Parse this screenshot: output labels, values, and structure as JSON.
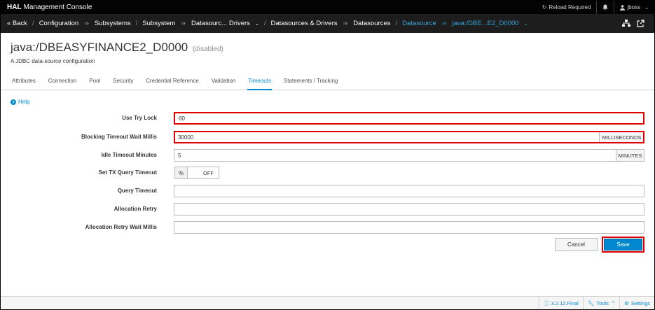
{
  "topbar": {
    "brand_bold": "HAL",
    "brand_rest": "Management Console",
    "reload": "Reload Required",
    "user": "jboss"
  },
  "breadcrumb": {
    "back": "« Back",
    "configuration": "Configuration",
    "subsystems": "Subsystems",
    "subsystem": "Subsystem",
    "subsystem_value": "Datasourc... Drivers",
    "ds_drivers": "Datasources & Drivers",
    "datasources": "Datasources",
    "datasource": "Datasource",
    "datasource_value": "java:/DBE...E2_D0000"
  },
  "header": {
    "title": "java:/DBEASYFINANCE2_D0000",
    "status": "(disabled)",
    "description": "A JDBC data-source configuration"
  },
  "tabs": [
    "Attributes",
    "Connection",
    "Pool",
    "Security",
    "Credential Reference",
    "Validation",
    "Timeouts",
    "Statements / Tracking"
  ],
  "help": "Help",
  "form": {
    "use_try_lock": {
      "label": "Use Try Lock",
      "value": "60"
    },
    "blocking_timeout": {
      "label": "Blocking Timeout Wait Millis",
      "value": "30000",
      "unit": "MILLISECONDS"
    },
    "idle_timeout": {
      "label": "Idle Timeout Minutes",
      "value": "5",
      "unit": "MINUTES"
    },
    "set_tx_query_timeout": {
      "label": "Set TX Query Timeout",
      "state": "OFF"
    },
    "query_timeout": {
      "label": "Query Timeout",
      "value": ""
    },
    "allocation_retry": {
      "label": "Allocation Retry",
      "value": ""
    },
    "allocation_retry_wait": {
      "label": "Allocation Retry Wait Millis",
      "value": ""
    }
  },
  "buttons": {
    "cancel": "Cancel",
    "save": "Save"
  },
  "footer": {
    "version": "3.2.12.Final",
    "tools": "Tools",
    "settings": "Settings"
  },
  "colors": {
    "accent": "#0088ce",
    "highlight": "#e00000",
    "topbar": "#030303",
    "crumbbar": "#1d1d1d"
  }
}
